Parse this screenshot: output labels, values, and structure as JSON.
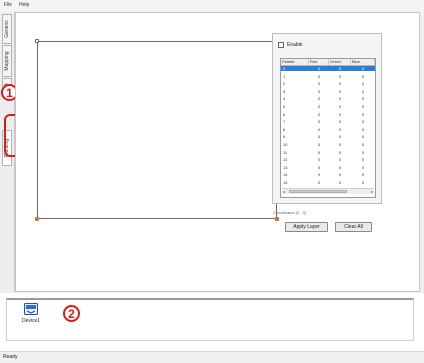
{
  "menu": {
    "file": "File",
    "help": "Help"
  },
  "tabs": [
    {
      "label": "Generic"
    },
    {
      "label": "Mapping"
    },
    {
      "label": "B"
    },
    {
      "label": "Painting"
    }
  ],
  "callouts": {
    "one": "1",
    "two": "2"
  },
  "palette_panel": {
    "enable_label": "Enable",
    "columns": [
      "Palette",
      "Red",
      "Green",
      "Blue"
    ],
    "rows": [
      [
        "0",
        "0",
        "0",
        "0"
      ],
      [
        "1",
        "0",
        "0",
        "0"
      ],
      [
        "2",
        "0",
        "0",
        "0"
      ],
      [
        "3",
        "0",
        "0",
        "0"
      ],
      [
        "4",
        "0",
        "0",
        "0"
      ],
      [
        "5",
        "0",
        "0",
        "0"
      ],
      [
        "6",
        "0",
        "0",
        "0"
      ],
      [
        "7",
        "0",
        "0",
        "0"
      ],
      [
        "8",
        "0",
        "0",
        "0"
      ],
      [
        "9",
        "0",
        "0",
        "0"
      ],
      [
        "10",
        "0",
        "0",
        "0"
      ],
      [
        "11",
        "0",
        "0",
        "0"
      ],
      [
        "12",
        "0",
        "0",
        "0"
      ],
      [
        "13",
        "0",
        "0",
        "0"
      ],
      [
        "14",
        "0",
        "0",
        "0"
      ],
      [
        "15",
        "0",
        "0",
        "0"
      ]
    ],
    "selected_row": 0,
    "coordinates": "Coordinates (0 , 0)"
  },
  "buttons": {
    "apply_layer": "Apply Layer",
    "clear_all": "Clear All"
  },
  "devices": [
    {
      "label": "Device1"
    }
  ],
  "status": {
    "text": "Ready"
  },
  "colors": {
    "selection": "#2a7fd4",
    "callout": "#e01818",
    "handle": "#c9743a"
  }
}
